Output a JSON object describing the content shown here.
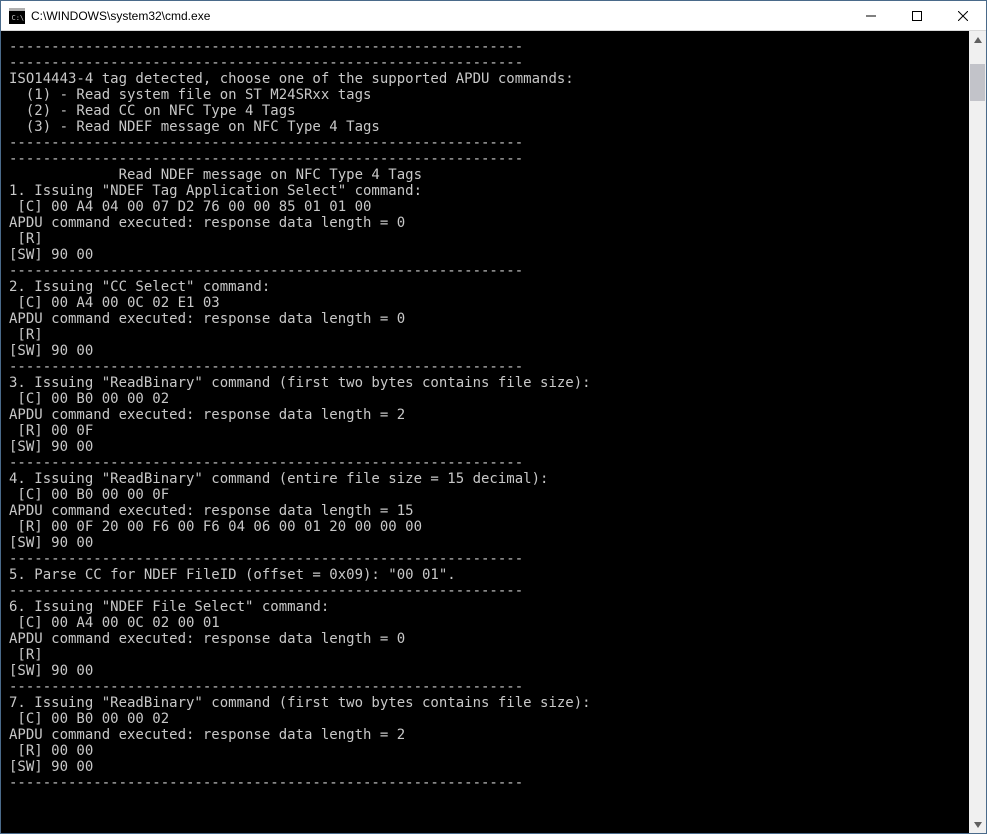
{
  "titlebar": {
    "icon_label": "cmd-icon",
    "title": "C:\\WINDOWS\\system32\\cmd.exe"
  },
  "scrollbar": {
    "thumb_top_pct": 2,
    "thumb_height_pct": 5
  },
  "terminal": {
    "lines": [
      "-------------------------------------------------------------",
      "-------------------------------------------------------------",
      "ISO14443-4 tag detected, choose one of the supported APDU commands:",
      "",
      "  (1) - Read system file on ST M24SRxx tags",
      "  (2) - Read CC on NFC Type 4 Tags",
      "  (3) - Read NDEF message on NFC Type 4 Tags",
      "-------------------------------------------------------------",
      "-------------------------------------------------------------",
      "             Read NDEF message on NFC Type 4 Tags",
      "",
      "1. Issuing \"NDEF Tag Application Select\" command:",
      " [C] 00 A4 04 00 07 D2 76 00 00 85 01 01 00",
      "APDU command executed: response data length = 0",
      " [R]",
      "[SW] 90 00",
      "-------------------------------------------------------------",
      "2. Issuing \"CC Select\" command:",
      " [C] 00 A4 00 0C 02 E1 03",
      "APDU command executed: response data length = 0",
      " [R]",
      "[SW] 90 00",
      "-------------------------------------------------------------",
      "3. Issuing \"ReadBinary\" command (first two bytes contains file size):",
      " [C] 00 B0 00 00 02",
      "APDU command executed: response data length = 2",
      " [R] 00 0F",
      "[SW] 90 00",
      "-------------------------------------------------------------",
      "4. Issuing \"ReadBinary\" command (entire file size = 15 decimal):",
      " [C] 00 B0 00 00 0F",
      "APDU command executed: response data length = 15",
      " [R] 00 0F 20 00 F6 00 F6 04 06 00 01 20 00 00 00",
      "[SW] 90 00",
      "-------------------------------------------------------------",
      "5. Parse CC for NDEF FileID (offset = 0x09): \"00 01\".",
      "-------------------------------------------------------------",
      "6. Issuing \"NDEF File Select\" command:",
      " [C] 00 A4 00 0C 02 00 01",
      "APDU command executed: response data length = 0",
      " [R]",
      "[SW] 90 00",
      "-------------------------------------------------------------",
      "7. Issuing \"ReadBinary\" command (first two bytes contains file size):",
      " [C] 00 B0 00 00 02",
      "APDU command executed: response data length = 2",
      " [R] 00 00",
      "[SW] 90 00",
      "-------------------------------------------------------------"
    ]
  }
}
